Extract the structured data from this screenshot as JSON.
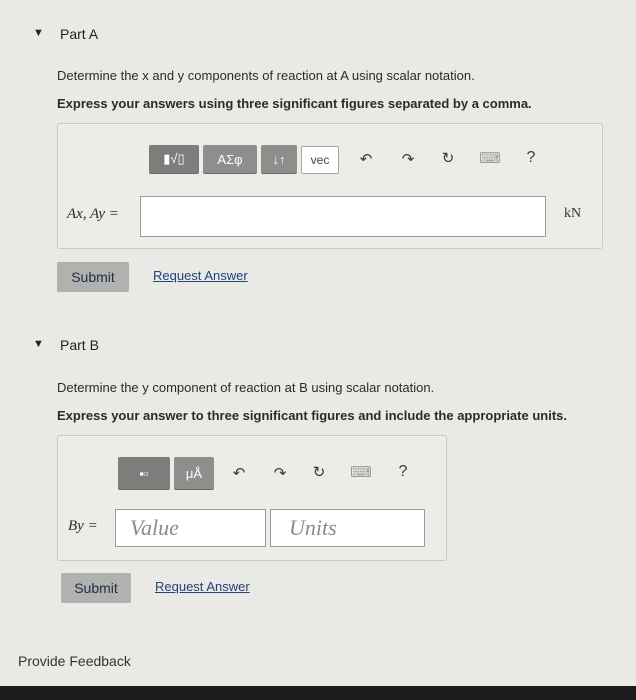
{
  "partA": {
    "title": "Part A",
    "question": "Determine the x and y components of reaction at A using scalar notation.",
    "instruction": "Express your answers using three significant figures separated by a comma.",
    "toolbar": {
      "templates_label": "▮√▯",
      "greek_label": "AΣφ",
      "arrows_label": "↓↑",
      "vec_label": "vec",
      "help_label": "?"
    },
    "answer_label": "Ax, Ay =",
    "answer_value": "",
    "unit": "kN",
    "submit_label": "Submit",
    "request_label": "Request Answer"
  },
  "partB": {
    "title": "Part B",
    "question": "Determine the y component of reaction at B using scalar notation.",
    "instruction": "Express your answer to three significant figures and include the appropriate units.",
    "toolbar": {
      "templates_label": "▪▫",
      "units_label": "μÅ",
      "help_label": "?"
    },
    "answer_label": "By =",
    "value_placeholder": "Value",
    "units_placeholder": "Units",
    "submit_label": "Submit",
    "request_label": "Request Answer"
  },
  "feedback_label": "Provide Feedback"
}
